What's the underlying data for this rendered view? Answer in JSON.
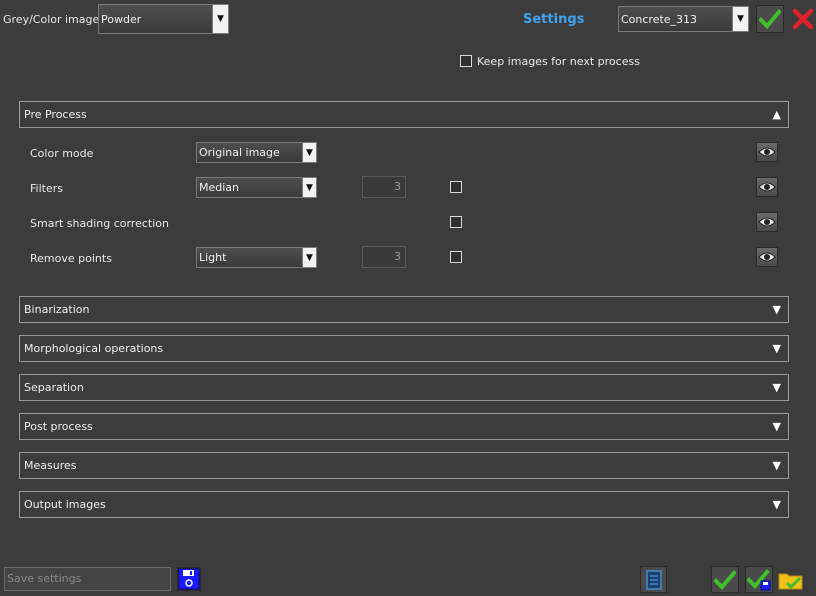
{
  "header": {
    "grey_color_label": "Grey/Color image",
    "grey_color_value": "Powder",
    "settings_title": "Settings",
    "settings_value": "Concrete_313",
    "keep_images_label": "Keep images for next process"
  },
  "preprocess": {
    "title": "Pre Process",
    "rows": {
      "color_mode": {
        "label": "Color mode",
        "value": "Original image"
      },
      "filters": {
        "label": "Filters",
        "value": "Median",
        "number": "3"
      },
      "smart_shading": {
        "label": "Smart shading correction"
      },
      "remove_points": {
        "label": "Remove points",
        "value": "Light",
        "number": "3"
      }
    }
  },
  "sections": {
    "binarization": "Binarization",
    "morphological": "Morphological operations",
    "separation": "Separation",
    "post_process": "Post process",
    "measures": "Measures",
    "output_images": "Output images"
  },
  "footer": {
    "save_placeholder": "Save settings"
  },
  "colors": {
    "accent_blue": "#3fa2ee",
    "ok_green": "#3fbf2a",
    "cancel_red": "#e0202a"
  }
}
